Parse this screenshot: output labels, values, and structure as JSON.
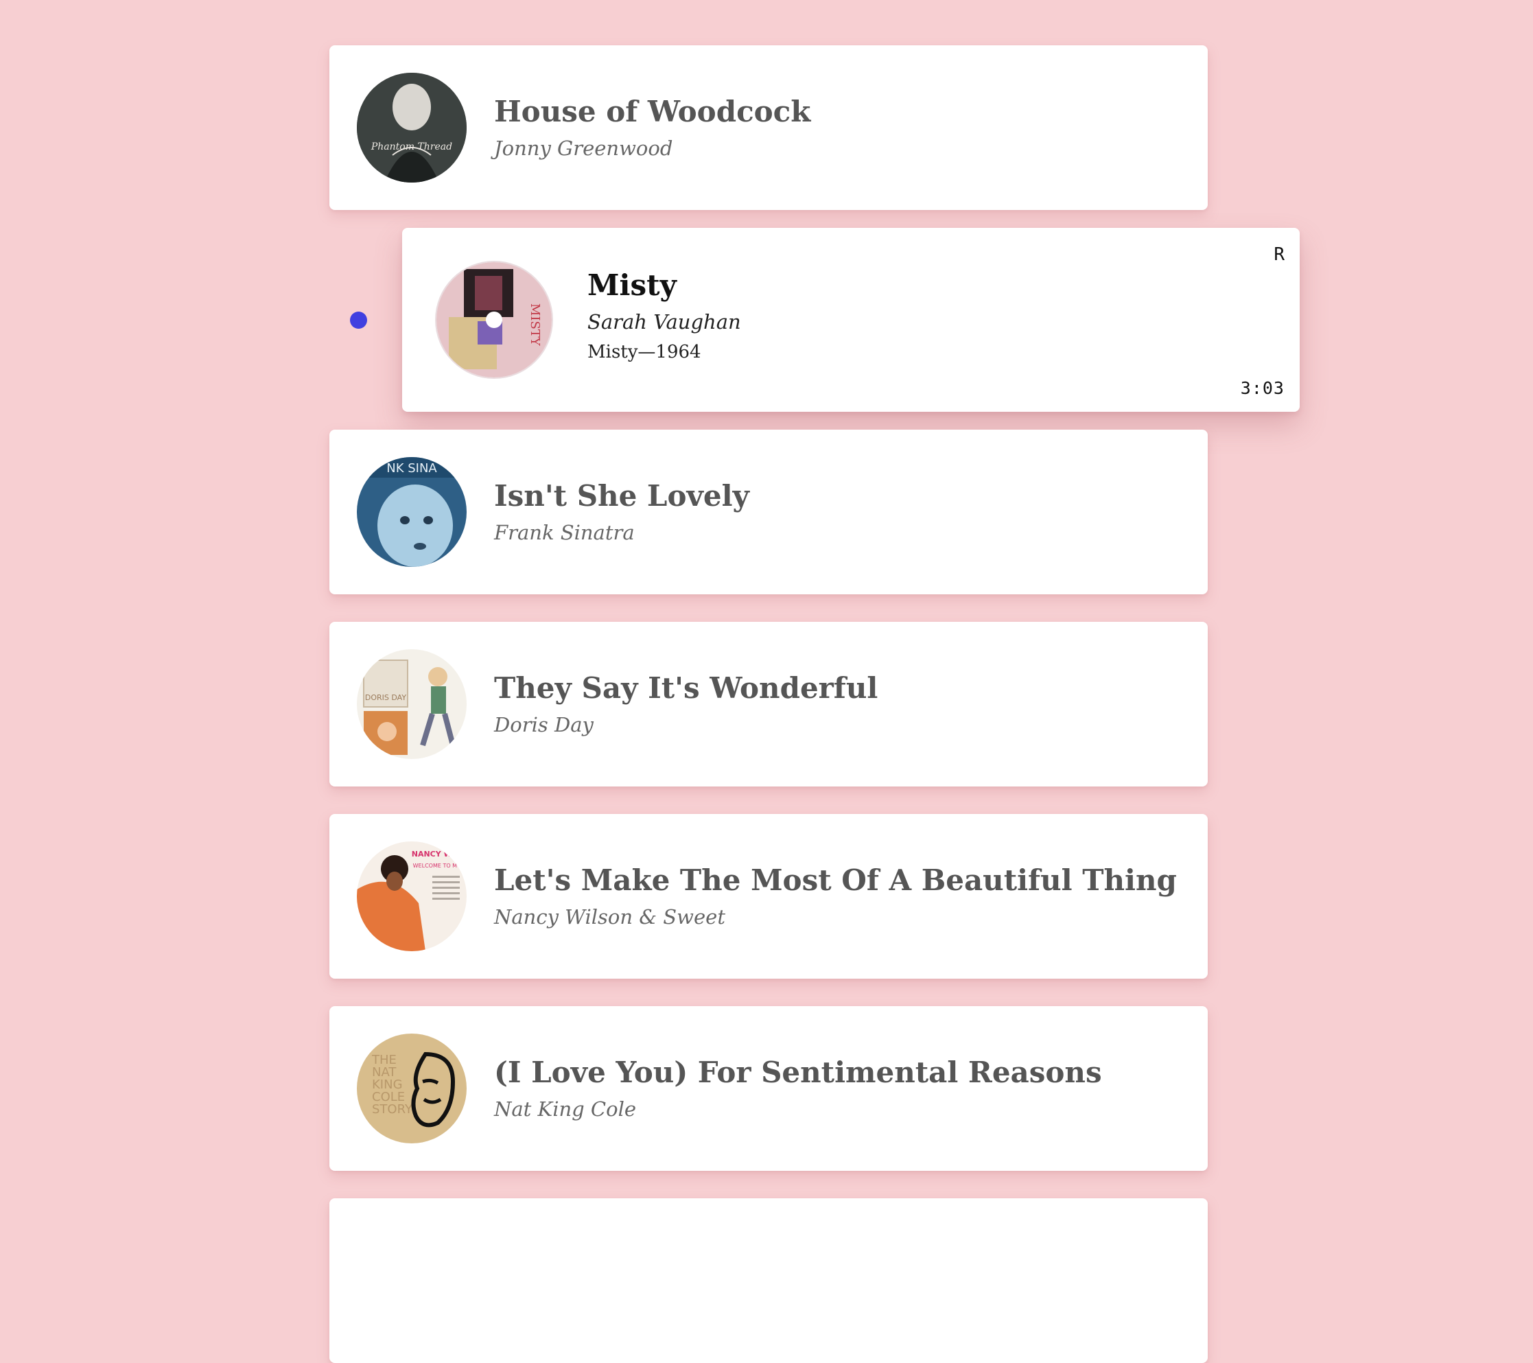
{
  "colors": {
    "background": "#f7cfd2",
    "card": "#ffffff",
    "indicator": "#4040e0"
  },
  "tracks": [
    {
      "title": "House of Woodcock",
      "artist": "Jonny Greenwood"
    },
    {
      "title": "Misty",
      "artist": "Sarah Vaughan",
      "album": "Misty—1964",
      "corner_label": "R",
      "duration": "3:03"
    },
    {
      "title": "Isn't She Lovely",
      "artist": "Frank Sinatra"
    },
    {
      "title": "They Say It's Wonderful",
      "artist": "Doris Day"
    },
    {
      "title": "Let's Make The Most Of A Beautiful Thing",
      "artist": "Nancy Wilson & Sweet"
    },
    {
      "title": "(I Love You) For Sentimental Reasons",
      "artist": "Nat King Cole"
    }
  ],
  "album_art_icons": [
    "phantom-thread-cover-icon",
    "misty-cover-icon",
    "sinatra-baby-cover-icon",
    "doris-day-cover-icon",
    "nancy-wilson-cover-icon",
    "nat-king-cole-cover-icon"
  ],
  "cover_text": {
    "phantom_thread": "Phantom Thread",
    "misty": "MISTY",
    "sinatra": "NK SINA",
    "doris": "DORIS DAY",
    "nancy_name": "NANCY WILSON",
    "nancy_welcome": "WELCOME TO MY LOVE",
    "nat_line1": "THE",
    "nat_line2": "NAT",
    "nat_line3": "KING",
    "nat_line4": "COLE",
    "nat_line5": "STORY"
  }
}
